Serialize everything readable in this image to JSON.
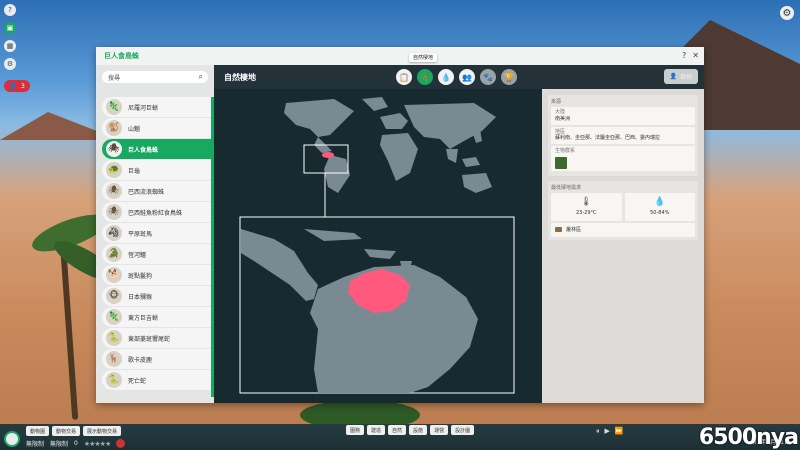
{
  "window": {
    "title": "巨人食鳥蛛"
  },
  "search": {
    "placeholder": "搜尋"
  },
  "hud": {
    "alert_count": "3"
  },
  "species_list": [
    {
      "label": "尼羅河巨蜥",
      "icon": "lizard-icon"
    },
    {
      "label": "山魈",
      "icon": "mandrill-icon"
    },
    {
      "label": "巨人食鳥蛛",
      "icon": "spider-icon",
      "selected": true
    },
    {
      "label": "巨龜",
      "icon": "tortoise-icon"
    },
    {
      "label": "巴西流浪蜘蛛",
      "icon": "spider-icon"
    },
    {
      "label": "巴西鮭魚粉紅食鳥蛛",
      "icon": "spider-icon"
    },
    {
      "label": "平原斑馬",
      "icon": "zebra-icon"
    },
    {
      "label": "恆河鱷",
      "icon": "gharial-icon"
    },
    {
      "label": "斑點鬣狗",
      "icon": "hyena-icon"
    },
    {
      "label": "日本獼猴",
      "icon": "macaque-icon"
    },
    {
      "label": "東方巨吉蜥",
      "icon": "lizard-icon"
    },
    {
      "label": "東部菱斑響尾蛇",
      "icon": "snake-icon"
    },
    {
      "label": "歌卡皮鹿",
      "icon": "okapi-icon"
    },
    {
      "label": "死亡蛇",
      "icon": "snake-icon"
    }
  ],
  "header": {
    "title": "自然棲地",
    "tooltip": "自然棲地",
    "right_button": "動物"
  },
  "tabs": [
    {
      "name": "tab-info",
      "glyph": "📋",
      "state": "normal"
    },
    {
      "name": "tab-habitat",
      "glyph": "🌴",
      "state": "active"
    },
    {
      "name": "tab-diet",
      "glyph": "💧",
      "state": "normal"
    },
    {
      "name": "tab-social",
      "glyph": "👥",
      "state": "normal"
    },
    {
      "name": "tab-enrichment",
      "glyph": "🐾",
      "state": "dim"
    },
    {
      "name": "tab-trophy",
      "glyph": "🏆",
      "state": "dim"
    }
  ],
  "info": {
    "origin_header": "來源",
    "continent_label": "大陸",
    "continent_value": "南美洲",
    "region_label": "地區",
    "region_value": "蘇利南、圭亞那、法屬圭亞那、巴西、委內瑞拉",
    "biome_label": "生物群系",
    "habitat_header": "最低棲地需求",
    "temperature": "23-29°C",
    "humidity": "50-84%",
    "floor_label": "叢林區"
  },
  "bottom": {
    "left_tabs": [
      "動物園",
      "動物交易",
      "展示動物交易"
    ],
    "money": "無限制",
    "research": "無限制",
    "guests": "0",
    "mid_tabs": [
      "園務",
      "建造",
      "自然",
      "設施",
      "運營",
      "設計圖"
    ],
    "date": "第1年1月11日"
  },
  "watermark": "6500nya",
  "colors": {
    "accent": "#18a862",
    "map_bg": "#172a30",
    "land": "#7a8a93",
    "range": "#ff5a7e"
  }
}
